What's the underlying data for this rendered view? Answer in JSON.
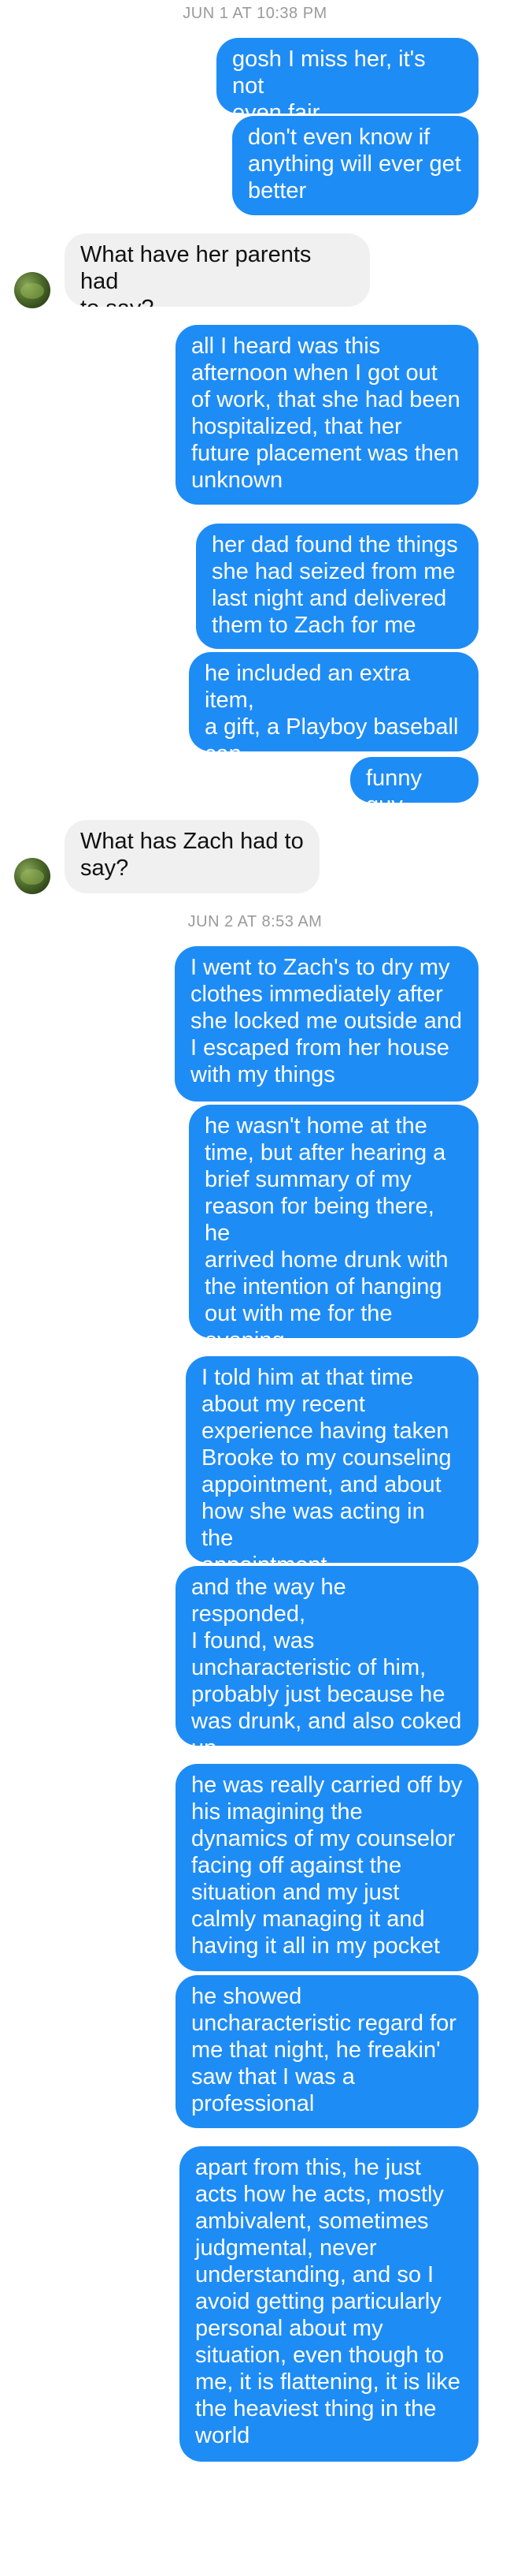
{
  "thread": {
    "timestamps": [
      "JUN 1 AT 10:38 PM",
      "JUN 2 AT 8:53 AM"
    ],
    "messages": [
      {
        "from": "me",
        "text": "gosh I miss her, it's not\neven fair"
      },
      {
        "from": "me",
        "text": "don't even know if\nanything will ever get\nbetter"
      },
      {
        "from": "them",
        "text": "What have her parents had\nto say?"
      },
      {
        "from": "me",
        "text": "all I heard was this\nafternoon when I got out\nof work, that she had been\nhospitalized, that her\nfuture placement was then\nunknown"
      },
      {
        "from": "me",
        "text": "her dad found the things\nshe had seized from me\nlast night and delivered\nthem to Zach for me"
      },
      {
        "from": "me",
        "text": "he included an extra item,\na gift, a Playboy baseball\ncap"
      },
      {
        "from": "me",
        "text": "funny guy"
      },
      {
        "from": "them",
        "text": "What has Zach had to\nsay?"
      },
      {
        "from": "me",
        "text": "I went to Zach's to dry my\nclothes immediately after\nshe locked me outside and\nI escaped from her house\nwith my things"
      },
      {
        "from": "me",
        "text": "he wasn't home at the\ntime, but after hearing a\nbrief summary of my\nreason for being there, he\narrived home drunk with\nthe intention of hanging\nout with me for the\nevening"
      },
      {
        "from": "me",
        "text": "I told him at that time\nabout my recent\nexperience having taken\nBrooke to my counseling\nappointment, and about\nhow she was acting in the\nappointment"
      },
      {
        "from": "me",
        "text": "and the way he responded,\nI found, was\nuncharacteristic of him,\nprobably just because he\nwas drunk, and also coked\nup"
      },
      {
        "from": "me",
        "text": "he was really carried off by\nhis imagining the\ndynamics of my counselor\nfacing off against the\nsituation and my just\ncalmly managing it and\nhaving it all in my pocket"
      },
      {
        "from": "me",
        "text": "he showed\nuncharacteristic regard for\nme that night, he freakin'\nsaw that I was a\nprofessional"
      },
      {
        "from": "me",
        "text": "apart from this, he just\nacts how he acts, mostly\nambivalent, sometimes\njudgmental, never\nunderstanding, and so I\navoid getting particularly\npersonal about my\nsituation, even though to\nme, it is flattening, it is like\nthe heaviest thing in the\nworld"
      }
    ]
  }
}
